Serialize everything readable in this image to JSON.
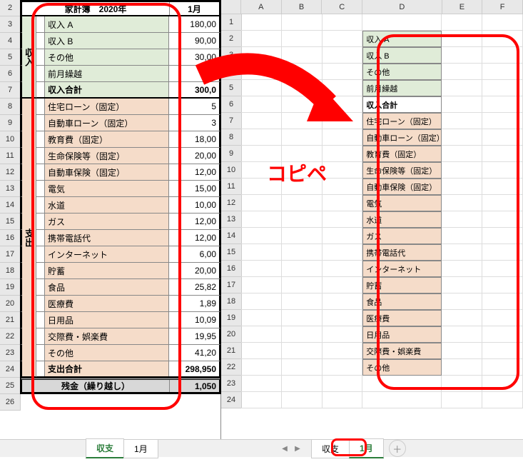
{
  "left": {
    "row_headers": [
      "2",
      "3",
      "4",
      "5",
      "6",
      "7",
      "8",
      "9",
      "10",
      "11",
      "12",
      "13",
      "14",
      "15",
      "16",
      "17",
      "18",
      "19",
      "20",
      "21",
      "22",
      "23",
      "24",
      "25",
      "26"
    ],
    "title_text": "家計簿　2020年",
    "month_header": "1月",
    "income_vertical": "収入",
    "expense_vertical": "支出",
    "income": [
      {
        "label": "収入 A",
        "value": "180,00"
      },
      {
        "label": "収入 B",
        "value": "90,00"
      },
      {
        "label": "その他",
        "value": "30,00"
      },
      {
        "label": "前月繰越",
        "value": ""
      }
    ],
    "income_sum_label": "収入合計",
    "income_sum_value": "300,0",
    "expense": [
      {
        "label": "住宅ローン（固定）",
        "value": "5"
      },
      {
        "label": "自動車ローン（固定）",
        "value": "3"
      },
      {
        "label": "教育費（固定）",
        "value": "18,00"
      },
      {
        "label": "生命保険等（固定）",
        "value": "20,00"
      },
      {
        "label": "自動車保険（固定）",
        "value": "12,00"
      },
      {
        "label": "電気",
        "value": "15,00"
      },
      {
        "label": "水道",
        "value": "10,00"
      },
      {
        "label": "ガス",
        "value": "12,00"
      },
      {
        "label": "携帯電話代",
        "value": "12,00"
      },
      {
        "label": "インターネット",
        "value": "6,00"
      },
      {
        "label": "貯蓄",
        "value": "20,00"
      },
      {
        "label": "食品",
        "value": "25,82"
      },
      {
        "label": "医療費",
        "value": "1,89"
      },
      {
        "label": "日用品",
        "value": "10,09"
      },
      {
        "label": "交際費・娯楽費",
        "value": "19,95"
      },
      {
        "label": "その他",
        "value": "41,20"
      }
    ],
    "expense_sum_label": "支出合計",
    "expense_sum_value": "298,950",
    "balance_label": "残金（繰り越し）",
    "balance_value": "1,050",
    "tabs": {
      "tab1": "収支",
      "tab2": "1月",
      "active": "収支"
    }
  },
  "right": {
    "col_headers": [
      "A",
      "B",
      "C",
      "D",
      "E",
      "F"
    ],
    "row_headers": [
      "1",
      "2",
      "3",
      "4",
      "5",
      "6",
      "7",
      "8",
      "9",
      "10",
      "11",
      "12",
      "13",
      "14",
      "15",
      "16",
      "17",
      "18",
      "19",
      "20",
      "21",
      "22",
      "23",
      "24"
    ],
    "pasted": [
      {
        "row": 2,
        "label": "収入 A",
        "cls": "pasted-income"
      },
      {
        "row": 3,
        "label": "収入 B",
        "cls": "pasted-income"
      },
      {
        "row": 4,
        "label": "その他",
        "cls": "pasted-income"
      },
      {
        "row": 5,
        "label": "前月繰越",
        "cls": "pasted-income"
      },
      {
        "row": 6,
        "label": "収入合計",
        "cls": "pasted-sum"
      },
      {
        "row": 7,
        "label": "住宅ローン（固定）",
        "cls": "pasted-expense"
      },
      {
        "row": 8,
        "label": "自動車ローン（固定）",
        "cls": "pasted-expense"
      },
      {
        "row": 9,
        "label": "教育費（固定）",
        "cls": "pasted-expense"
      },
      {
        "row": 10,
        "label": "生命保険等（固定）",
        "cls": "pasted-expense"
      },
      {
        "row": 11,
        "label": "自動車保険（固定）",
        "cls": "pasted-expense"
      },
      {
        "row": 12,
        "label": "電気",
        "cls": "pasted-expense"
      },
      {
        "row": 13,
        "label": "水道",
        "cls": "pasted-expense"
      },
      {
        "row": 14,
        "label": "ガス",
        "cls": "pasted-expense"
      },
      {
        "row": 15,
        "label": "携帯電話代",
        "cls": "pasted-expense"
      },
      {
        "row": 16,
        "label": "インターネット",
        "cls": "pasted-expense"
      },
      {
        "row": 17,
        "label": "貯蓄",
        "cls": "pasted-expense"
      },
      {
        "row": 18,
        "label": "食品",
        "cls": "pasted-expense"
      },
      {
        "row": 19,
        "label": "医療費",
        "cls": "pasted-expense"
      },
      {
        "row": 20,
        "label": "日用品",
        "cls": "pasted-expense"
      },
      {
        "row": 21,
        "label": "交際費・娯楽費",
        "cls": "pasted-expense"
      },
      {
        "row": 22,
        "label": "その他",
        "cls": "pasted-expense"
      }
    ],
    "tabs": {
      "tab1": "収支",
      "tab2": "1月",
      "active": "1月"
    }
  },
  "annotation": {
    "copipe": "コピペ"
  }
}
